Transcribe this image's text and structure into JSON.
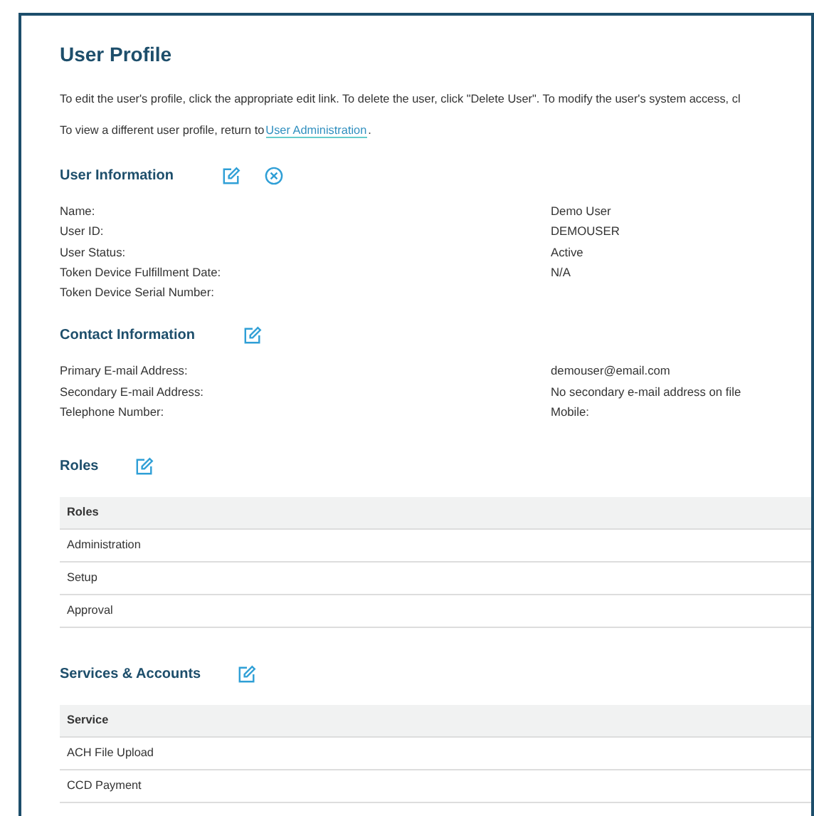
{
  "title": "User Profile",
  "intro": "To edit the user's profile, click the appropriate edit link. To delete the user, click \"Delete User\". To modify the user's system access, cl",
  "view_line": {
    "text": "To view a different user profile, return to",
    "link": "User Administration",
    "after": "."
  },
  "sections": [
    {
      "kind": "details",
      "title": "User Information",
      "actions": [
        {
          "kind": "edit"
        },
        {
          "kind": "delete"
        }
      ],
      "rows": [
        {
          "label": "Name:",
          "value": "Demo User"
        },
        {
          "label": "User ID:",
          "value": "DEMOUSER"
        },
        {
          "label": "User Status:",
          "value": "Active"
        },
        {
          "label": "Token Device Fulfillment Date:",
          "value": "N/A"
        },
        {
          "label": "Token Device Serial Number:"
        }
      ]
    },
    {
      "kind": "details",
      "title": "Contact Information",
      "actions": [
        {
          "kind": "edit"
        }
      ],
      "rows": [
        {
          "label": "Primary E-mail Address:",
          "value": "demouser@email.com"
        },
        {
          "label": "Secondary E-mail Address:",
          "value": "No secondary e-mail address on file"
        },
        {
          "label": "Telephone Number:",
          "value": "Mobile:"
        }
      ]
    },
    {
      "kind": "table",
      "title": "Roles",
      "actions": [
        {
          "kind": "edit"
        }
      ],
      "header": "Roles",
      "rows": [
        "Administration",
        "Setup",
        "Approval"
      ]
    },
    {
      "kind": "table",
      "title": "Services & Accounts",
      "actions": [
        {
          "kind": "edit"
        }
      ],
      "header": "Service",
      "rows": [
        "ACH File Upload",
        "CCD Payment"
      ]
    }
  ]
}
